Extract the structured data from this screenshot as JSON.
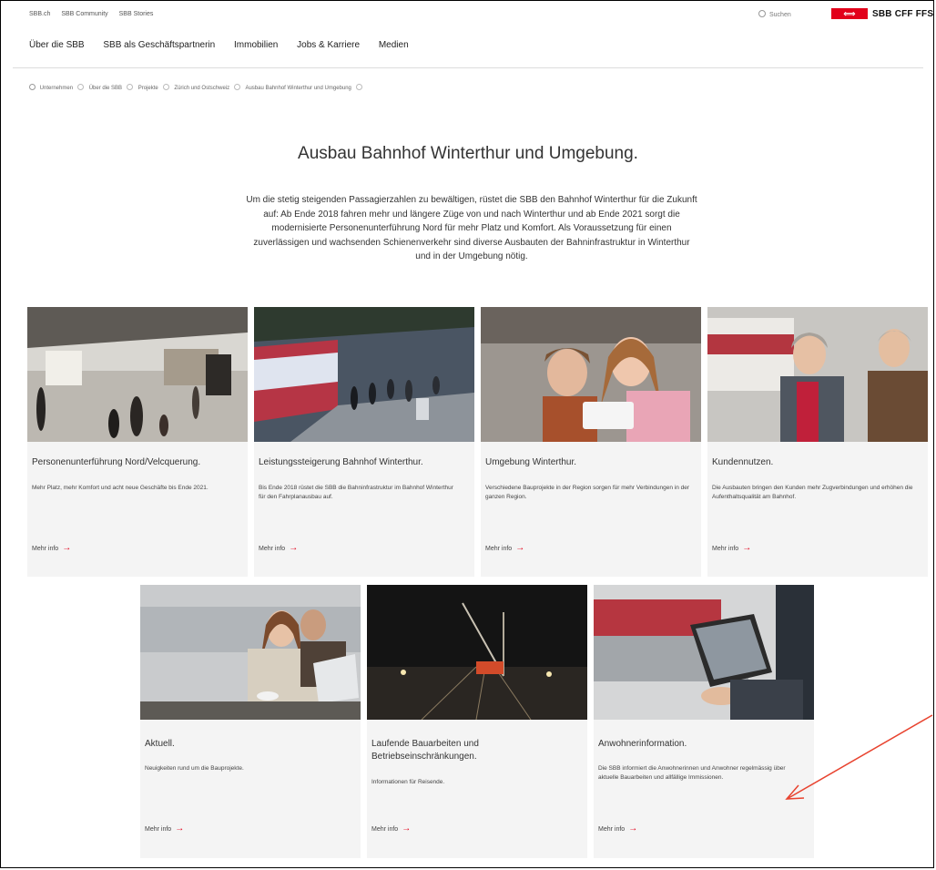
{
  "header": {
    "top_links": [
      "SBB.ch",
      "SBB Community",
      "SBB Stories"
    ],
    "search_label": "Suchen",
    "logo_text": "SBB CFF FFS",
    "logo_mark": "⟺",
    "nav": [
      "Über die SBB",
      "SBB als Geschäftspartnerin",
      "Immobilien",
      "Jobs & Karriere",
      "Medien"
    ]
  },
  "breadcrumb": [
    "Unternehmen",
    "Über die SBB",
    "Projekte",
    "Zürich und Ostschweiz",
    "Ausbau Bahnhof Winterthur und Umgebung"
  ],
  "page": {
    "title": "Ausbau Bahnhof Winterthur und Umgebung.",
    "intro": "Um die stetig steigenden Passagierzahlen zu bewältigen, rüstet die SBB den Bahnhof Winterthur für die Zukunft auf: Ab Ende 2018 fahren mehr und längere Züge von und nach Winterthur und ab Ende 2021 sorgt die modernisierte Personenunterführung Nord für mehr Platz und Komfort. Als Voraussetzung für einen zuverlässigen und wachsenden Schienenverkehr sind diverse Ausbauten der Bahninfrastruktur in Winterthur und in der Umgebung nötig."
  },
  "cards": [
    {
      "title": "Personenunterführung Nord/Velcquerung.",
      "text": "Mehr Platz, mehr Komfort und acht neue Geschäfte bis Ende 2021.",
      "link": "Mehr info"
    },
    {
      "title": "Leistungssteigerung Bahnhof Winterthur.",
      "text": "Bis Ende 2018 rüstet die SBB die Bahninfrastruktur im Bahnhof Winterthur für den Fahrplanausbau auf.",
      "link": "Mehr info"
    },
    {
      "title": "Umgebung Winterthur.",
      "text": "Verschiedene Bauprojekte in der Region sorgen für mehr Verbindungen in der ganzen Region.",
      "link": "Mehr info"
    },
    {
      "title": "Kundennutzen.",
      "text": "Die Ausbauten bringen den Kunden mehr Zugverbindungen und erhöhen die Aufenthaltsqualität am Bahnhof.",
      "link": "Mehr info"
    },
    {
      "title": "Aktuell.",
      "text": "Neuigkeiten rund um die Bauprojekte.",
      "link": "Mehr info"
    },
    {
      "title": "Laufende Bauarbeiten und Betriebseinschränkungen.",
      "text": "Informationen für Reisende.",
      "link": "Mehr info"
    },
    {
      "title": "Anwohnerinformation.",
      "text": "Die SBB informiert die Anwohnerinnen und Anwohner regelmässig über aktuelle Bauarbeiten und allfällige Immissionen.",
      "link": "Mehr info"
    }
  ],
  "icons": {
    "search": "search-icon",
    "home": "home-icon",
    "arrow": "arrow-right-icon",
    "annotation": "red-annotation-arrow"
  },
  "colors": {
    "brand_red": "#e2001a",
    "card_bg": "#f4f4f4",
    "annotation_red": "#e8432f"
  },
  "arrow_glyph": "→"
}
